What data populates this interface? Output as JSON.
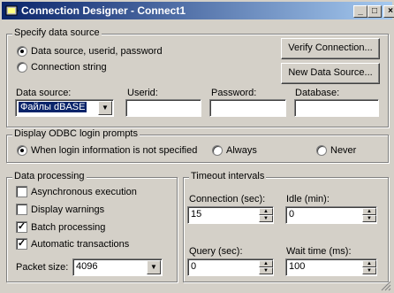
{
  "window": {
    "title": "Connection Designer - Connect1",
    "minimize": "_",
    "maximize": "□",
    "close": "×"
  },
  "specify": {
    "legend": "Specify data source",
    "radio_dsn": "Data source, userid, password",
    "radio_conn": "Connection string",
    "verify_button": "Verify Connection...",
    "new_ds_button": "New Data Source...",
    "data_source_label": "Data source:",
    "data_source_value": "Файлы dBASE",
    "userid_label": "Userid:",
    "userid_value": "",
    "password_label": "Password:",
    "password_value": "",
    "database_label": "Database:",
    "database_value": ""
  },
  "prompt": {
    "legend": "Display ODBC login prompts",
    "opt1": "When login information is not specified",
    "opt2": "Always",
    "opt3": "Never"
  },
  "processing": {
    "legend": "Data processing",
    "async": "Asynchronous execution",
    "warnings": "Display warnings",
    "batch": "Batch processing",
    "auto": "Automatic transactions",
    "packet_label": "Packet size:",
    "packet_value": "4096",
    "async_checked": false,
    "warnings_checked": false,
    "batch_checked": true,
    "auto_checked": true
  },
  "timeout": {
    "legend": "Timeout intervals",
    "connection_label": "Connection (sec):",
    "connection_value": "15",
    "idle_label": "Idle (min):",
    "idle_value": "0",
    "query_label": "Query (sec):",
    "query_value": "0",
    "wait_label": "Wait time (ms):",
    "wait_value": "100"
  }
}
